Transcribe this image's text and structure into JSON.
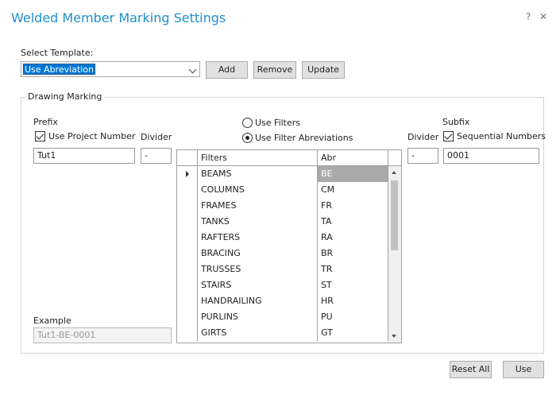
{
  "window": {
    "title": "Welded Member Marking Settings",
    "help_glyph": "?",
    "close_glyph": "✕"
  },
  "template": {
    "label": "Select Template:",
    "selected": "Use Abreviation",
    "add_label": "Add",
    "remove_label": "Remove",
    "update_label": "Update"
  },
  "drawing_marking": {
    "title": "Drawing Marking",
    "prefix": {
      "label": "Prefix",
      "use_project_number_label": "Use Project Number",
      "use_project_number_checked": true,
      "value": "Tut1",
      "divider_label": "Divider",
      "divider_value": "-"
    },
    "filter_mode": {
      "use_filters_label": "Use Filters",
      "use_filter_abbreviations_label": "Use Filter Abreviations",
      "selected": "use_filter_abbreviations"
    },
    "grid": {
      "columns": [
        "Filters",
        "Abr"
      ],
      "rows": [
        {
          "filter": "BEAMS",
          "abr": "BE"
        },
        {
          "filter": "COLUMNS",
          "abr": "CM"
        },
        {
          "filter": "FRAMES",
          "abr": "FR"
        },
        {
          "filter": "TANKS",
          "abr": "TA"
        },
        {
          "filter": "RAFTERS",
          "abr": "RA"
        },
        {
          "filter": "BRACING",
          "abr": "BR"
        },
        {
          "filter": "TRUSSES",
          "abr": "TR"
        },
        {
          "filter": "STAIRS",
          "abr": "ST"
        },
        {
          "filter": "HANDRAILING",
          "abr": "HR"
        },
        {
          "filter": "PURLINS",
          "abr": "PU"
        },
        {
          "filter": "GIRTS",
          "abr": "GT"
        }
      ],
      "selected_row": 0
    },
    "suffix": {
      "label": "Subfix",
      "divider_label": "Divider",
      "divider_value": "-",
      "sequential_numbers_label": "Sequential Numbers",
      "sequential_numbers_checked": true,
      "value": "0001"
    },
    "example": {
      "label": "Example",
      "value": "Tut1-BE-0001"
    }
  },
  "footer": {
    "reset_all_label": "Reset All",
    "use_label": "Use"
  }
}
